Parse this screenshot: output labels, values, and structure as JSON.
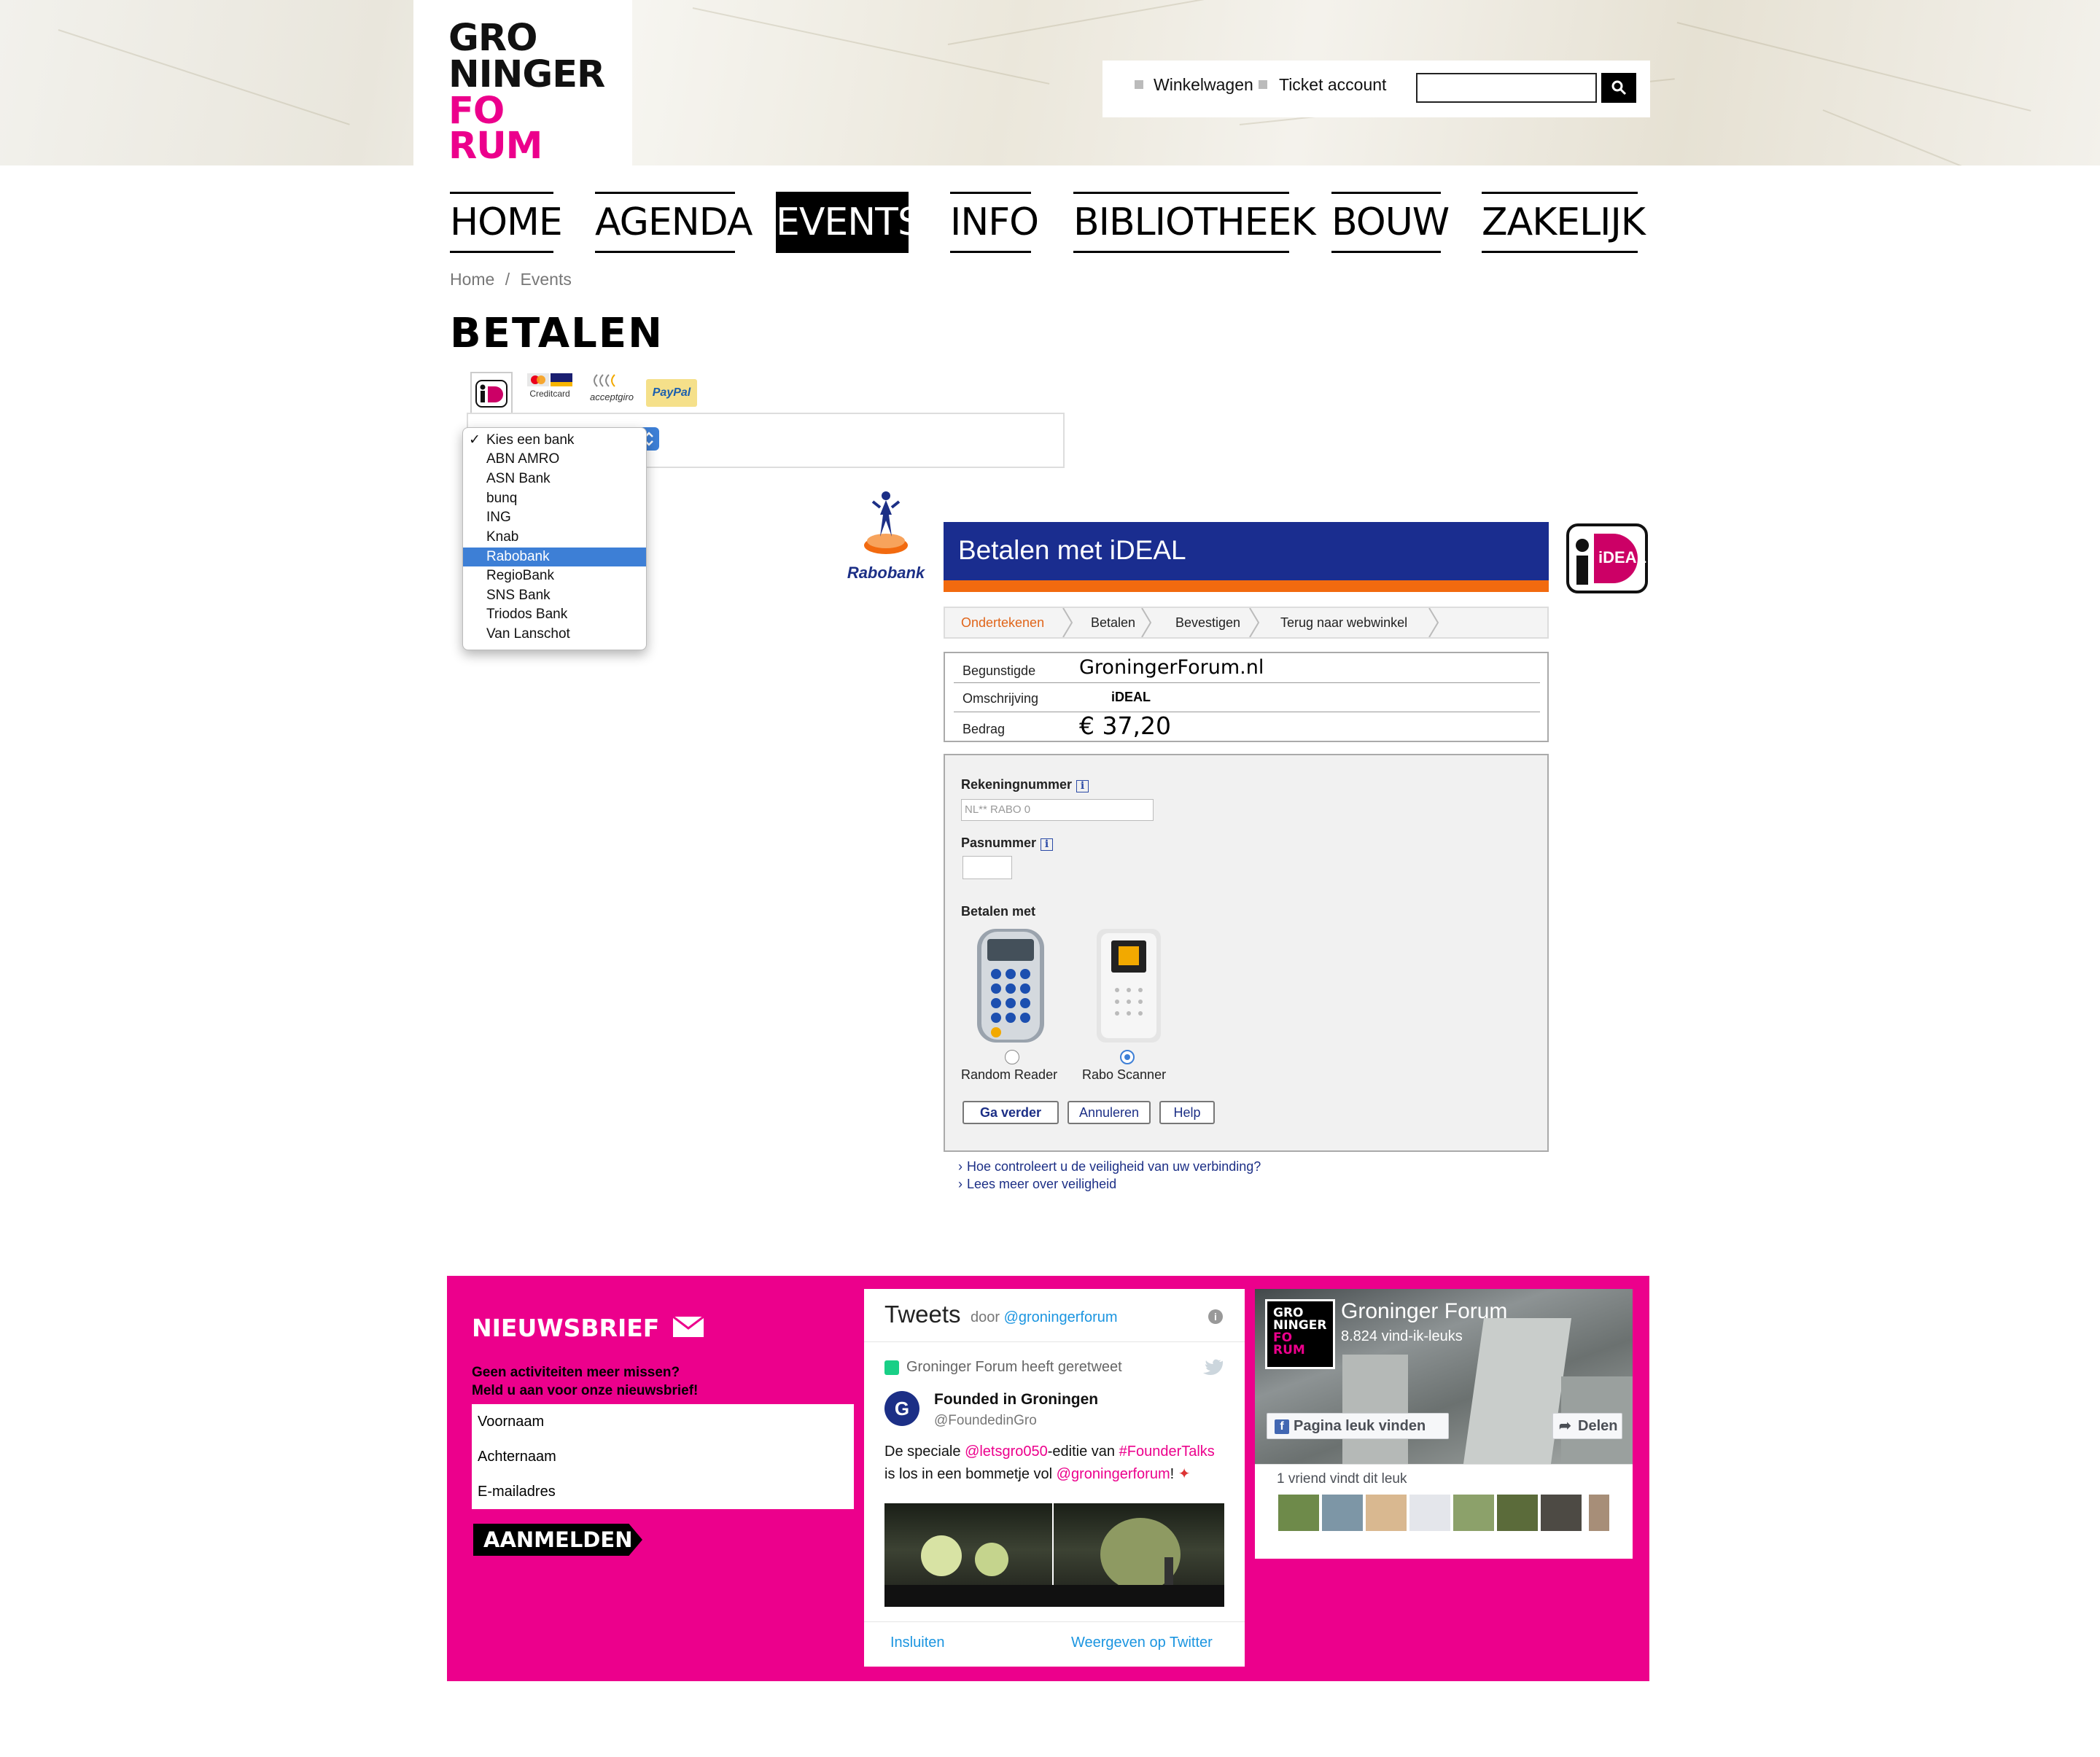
{
  "logo": {
    "line1": "GRO",
    "line2": "NINGER",
    "line3": "FO",
    "line4": "RUM",
    "black": "#111111",
    "pink": "#ec008c"
  },
  "header": {
    "cart_label": "Winkelwagen",
    "account_label": "Ticket account",
    "search_value": "",
    "search_icon": "search-icon"
  },
  "nav": {
    "items": [
      "HOME",
      "AGENDA",
      "EVENTS",
      "INFO",
      "BIBLIOTHEEK",
      "BOUW",
      "ZAKELIJK"
    ],
    "active": "EVENTS"
  },
  "breadcrumb": {
    "home": "Home",
    "sep": "/",
    "current": "Events"
  },
  "page_title": "BETALEN",
  "payment_tabs": {
    "ideal": "iDEAL",
    "creditcard": "Creditcard",
    "acceptgiro": "acceptgiro",
    "paypal": "PayPal"
  },
  "bank_dropdown": {
    "options": [
      "Kies een bank",
      "ABN AMRO",
      "ASN Bank",
      "bunq",
      "ING",
      "Knab",
      "Rabobank",
      "RegioBank",
      "SNS Bank",
      "Triodos Bank",
      "Van Lanschot"
    ],
    "checked": "Kies een bank",
    "highlighted": "Rabobank"
  },
  "ideal": {
    "bank_name": "Rabobank",
    "header": "Betalen met iDEAL",
    "logo_text": "iDEAL",
    "steps": [
      "Ondertekenen",
      "Betalen",
      "Bevestigen",
      "Terug naar webwinkel"
    ],
    "active_step": "Ondertekenen",
    "details": {
      "beneficiary_label": "Begunstigde",
      "beneficiary_value": "GroningerForum.nl",
      "description_label": "Omschrijving",
      "description_value": "iDEAL",
      "amount_label": "Bedrag",
      "amount_value": "€ 37,20"
    },
    "form": {
      "account_label": "Rekeningnummer",
      "account_prefix": "NL** RABO 0",
      "account_value": "",
      "card_label": "Pasnummer",
      "card_value": "",
      "pay_with_label": "Betalen met",
      "device_options": [
        "Random Reader",
        "Rabo Scanner"
      ],
      "selected_device": "Rabo Scanner",
      "buttons": {
        "continue": "Ga verder",
        "cancel": "Annuleren",
        "help": "Help"
      }
    },
    "links": [
      "Hoe controleert u de veiligheid van uw verbinding?",
      "Lees meer over veiligheid"
    ],
    "colors": {
      "header_blue": "#1a2d8f",
      "stripe_orange": "#f26a0f",
      "step_active": "#e0651a"
    }
  },
  "newsletter": {
    "title": "NIEUWSBRIEF",
    "text1": "Geen activiteiten meer missen?",
    "text2": "Meld u aan voor onze nieuwsbrief!",
    "fields": [
      "Voornaam",
      "Achternaam",
      "E-mailadres"
    ],
    "button": "AANMELDEN"
  },
  "tweets": {
    "title": "Tweets",
    "by": "door",
    "handle": "@groningerforum",
    "retweet_label": "Groninger Forum heeft geretweet",
    "author_name": "Founded in Groningen",
    "author_handle": "@FoundedinGro",
    "text_a": "De speciale ",
    "mention1": "@letsgro050",
    "text_b": "-editie van ",
    "hashtag": "#FounderTalks",
    "text_c": "is los in een bommetje vol ",
    "mention2": "@groningerforum",
    "text_d": "!",
    "embed_label": "Insluiten",
    "view_label": "Weergeven op Twitter"
  },
  "facebook": {
    "page_name": "Groninger Forum",
    "likes": "8.824 vind-ik-leuks",
    "like_button": "Pagina leuk vinden",
    "share_button": "Delen",
    "friends_text": "1 vriend vindt dit leuk"
  },
  "brand_pink": "#ec008c"
}
